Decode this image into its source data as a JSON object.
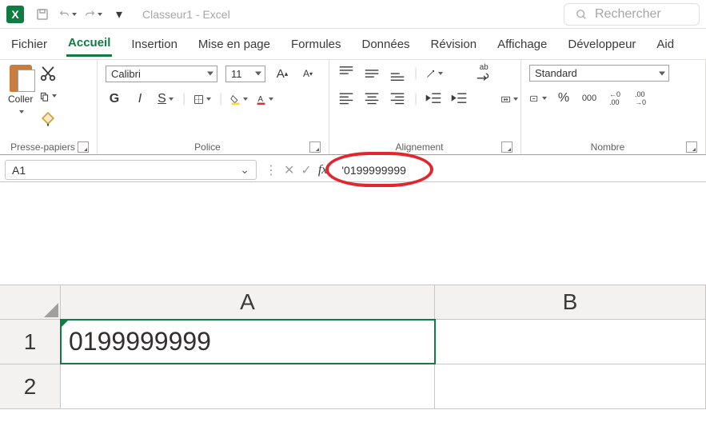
{
  "title": {
    "document": "Classeur1",
    "app_suffix": " - Excel",
    "logo_letter": "X"
  },
  "search": {
    "placeholder": "Rechercher"
  },
  "tabs": [
    "Fichier",
    "Accueil",
    "Insertion",
    "Mise en page",
    "Formules",
    "Données",
    "Révision",
    "Affichage",
    "Développeur",
    "Aid"
  ],
  "active_tab_index": 1,
  "ribbon": {
    "clipboard": {
      "paste": "Coller",
      "group": "Presse-papiers"
    },
    "font": {
      "family": "Calibri",
      "size": "11",
      "bold": "G",
      "italic": "I",
      "underline": "S",
      "increase": "A",
      "decrease": "A",
      "group": "Police"
    },
    "alignment": {
      "wrap": "ab",
      "group": "Alignement"
    },
    "number": {
      "format": "Standard",
      "thousands_sep": "000",
      "group": "Nombre"
    }
  },
  "formulabar": {
    "namebox": "A1",
    "fx": "fx",
    "value": "'0199999999"
  },
  "grid": {
    "columns": [
      "A",
      "B"
    ],
    "rows": [
      {
        "num": "1",
        "cells": [
          "0199999999",
          ""
        ]
      },
      {
        "num": "2",
        "cells": [
          "",
          ""
        ]
      }
    ],
    "selected": {
      "row": 0,
      "col": 0
    }
  }
}
